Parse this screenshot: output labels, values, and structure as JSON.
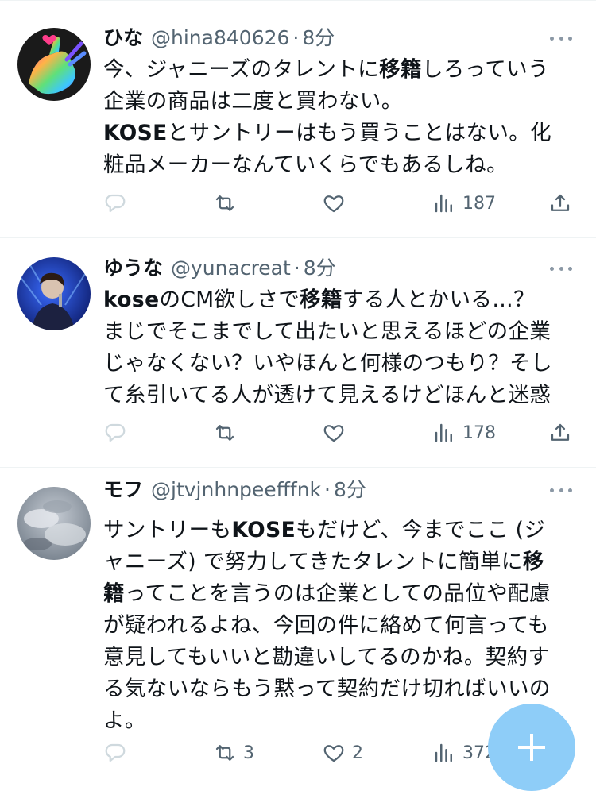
{
  "tweets": [
    {
      "name": "ひな",
      "handle": "@hina840626",
      "dot": "·",
      "time": "8分",
      "avatar": "avatar-rainbow-heart-hand",
      "lines": [
        [
          {
            "t": "今、ジャニーズのタレントに"
          },
          {
            "t": "移籍",
            "b": true
          },
          {
            "t": "しろっていう"
          }
        ],
        [
          {
            "t": "企業の商品は二度と買わない。"
          }
        ],
        [
          {
            "t": "KOSE",
            "b": true
          },
          {
            "t": "とサントリーはもう買うことはない。化"
          }
        ],
        [
          {
            "t": "粧品メーカーなんていくらでもあるしね。"
          }
        ]
      ],
      "replies": "",
      "retweets": "",
      "likes": "",
      "views": "187"
    },
    {
      "name": "ゆうな",
      "handle": "@yunacreat",
      "dot": "·",
      "time": "8分",
      "avatar": "avatar-stage-performer",
      "lines": [
        [
          {
            "t": "kose",
            "b": true
          },
          {
            "t": "のCM欲しさで"
          },
          {
            "t": "移籍",
            "b": true
          },
          {
            "t": "する人とかいる…？"
          }
        ],
        [
          {
            "t": "まじでそこまでして出たいと思えるほどの企業"
          }
        ],
        [
          {
            "t": "じゃなくない？いやほんと何様のつもり？そし"
          }
        ],
        [
          {
            "t": "て糸引いてる人が透けて見えるけどほんと迷惑"
          }
        ]
      ],
      "replies": "",
      "retweets": "",
      "likes": "",
      "views": "178"
    },
    {
      "name": "モフ",
      "handle": "@jtvjnhnpeefffnk",
      "dot": "·",
      "time": "8分",
      "avatar": "avatar-cloudy-sky",
      "lines": [
        [
          {
            "t": "サントリーも"
          },
          {
            "t": "KOSE",
            "b": true
          },
          {
            "t": "もだけど、今までここ (ジ"
          }
        ],
        [
          {
            "t": "ャニーズ) で努力してきたタレントに簡単に"
          },
          {
            "t": "移",
            "b": true
          }
        ],
        [
          {
            "t": "籍",
            "b": true
          },
          {
            "t": "ってことを言うのは企業としての品位や配慮"
          }
        ],
        [
          {
            "t": "が疑われるよね、今回の件に絡めて何言っても"
          }
        ],
        [
          {
            "t": "意見してもいいと勘違いしてるのかね。契約す"
          }
        ],
        [
          {
            "t": "る気ないならもう黙って契約だけ切ればいいの"
          }
        ],
        [
          {
            "t": "よ。"
          }
        ]
      ],
      "replies": "",
      "retweets": "3",
      "likes": "2",
      "views": "372"
    }
  ],
  "icons": {
    "reply": "reply-icon",
    "retweet": "retweet-icon",
    "like": "heart-icon",
    "views": "views-icon",
    "share": "share-icon",
    "more": "more-icon",
    "compose": "compose-plus-icon"
  },
  "colors": {
    "icon_gray": "#536471",
    "reply_faded": "#cfd9de",
    "fab": "#8ecdf8"
  }
}
